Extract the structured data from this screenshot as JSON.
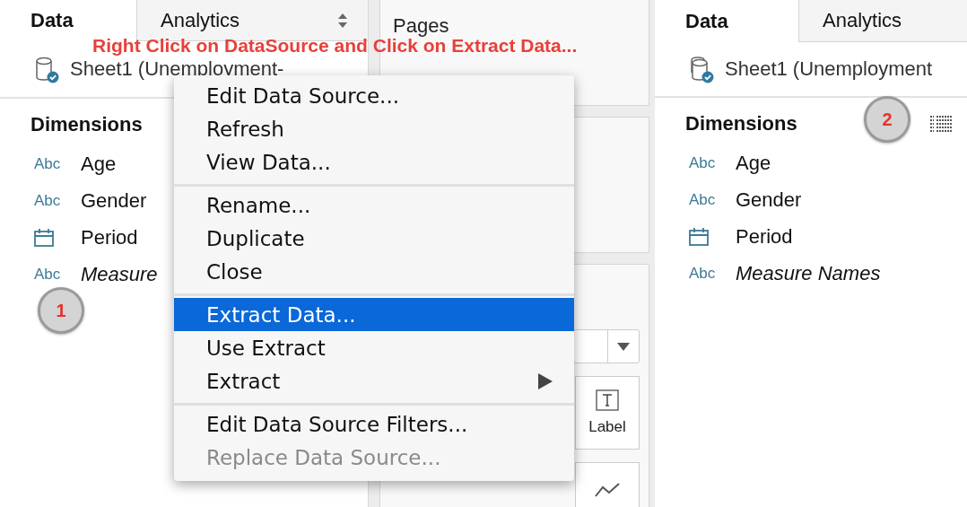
{
  "annotation": "Right Click on DataSource and Click on Extract Data...",
  "left_pane": {
    "tabs": [
      {
        "label": "Data",
        "selected": true
      },
      {
        "label": "Analytics",
        "selected": false
      }
    ],
    "data_source": "Sheet1 (Unemployment-",
    "section": "Dimensions",
    "callout": "1",
    "fields": [
      {
        "kind": "text",
        "type_label": "Abc",
        "name": "Age",
        "italic": false
      },
      {
        "kind": "text",
        "type_label": "Abc",
        "name": "Gender",
        "italic": false
      },
      {
        "kind": "date",
        "name": "Period",
        "italic": false
      },
      {
        "kind": "text",
        "type_label": "Abc",
        "name": "Measure",
        "italic": true
      }
    ]
  },
  "middle": {
    "pages_title": "Pages",
    "marks": {
      "label_button": "Label"
    }
  },
  "context_menu": {
    "groups": [
      {
        "items": [
          {
            "label": "Edit Data Source...",
            "highlighted": false,
            "disabled": false,
            "submenu": false
          },
          {
            "label": "Refresh",
            "highlighted": false,
            "disabled": false,
            "submenu": false
          },
          {
            "label": "View Data...",
            "highlighted": false,
            "disabled": false,
            "submenu": false
          }
        ]
      },
      {
        "items": [
          {
            "label": "Rename...",
            "highlighted": false,
            "disabled": false,
            "submenu": false
          },
          {
            "label": "Duplicate",
            "highlighted": false,
            "disabled": false,
            "submenu": false
          },
          {
            "label": "Close",
            "highlighted": false,
            "disabled": false,
            "submenu": false
          }
        ]
      },
      {
        "items": [
          {
            "label": "Extract Data...",
            "highlighted": true,
            "disabled": false,
            "submenu": false
          },
          {
            "label": "Use Extract",
            "highlighted": false,
            "disabled": false,
            "submenu": false
          },
          {
            "label": "Extract",
            "highlighted": false,
            "disabled": false,
            "submenu": true
          }
        ]
      },
      {
        "items": [
          {
            "label": "Edit Data Source Filters...",
            "highlighted": false,
            "disabled": false,
            "submenu": false
          },
          {
            "label": "Replace Data Source...",
            "highlighted": false,
            "disabled": true,
            "submenu": false
          }
        ]
      }
    ]
  },
  "right_pane": {
    "tabs": [
      {
        "label": "Data",
        "selected": true
      },
      {
        "label": "Analytics",
        "selected": false
      }
    ],
    "data_source": "Sheet1 (Unemployment",
    "section": "Dimensions",
    "callout": "2",
    "fields": [
      {
        "kind": "text",
        "type_label": "Abc",
        "name": "Age",
        "italic": false
      },
      {
        "kind": "text",
        "type_label": "Abc",
        "name": "Gender",
        "italic": false
      },
      {
        "kind": "date",
        "name": "Period",
        "italic": false
      },
      {
        "kind": "text",
        "type_label": "Abc",
        "name": "Measure Names",
        "italic": true
      }
    ]
  }
}
